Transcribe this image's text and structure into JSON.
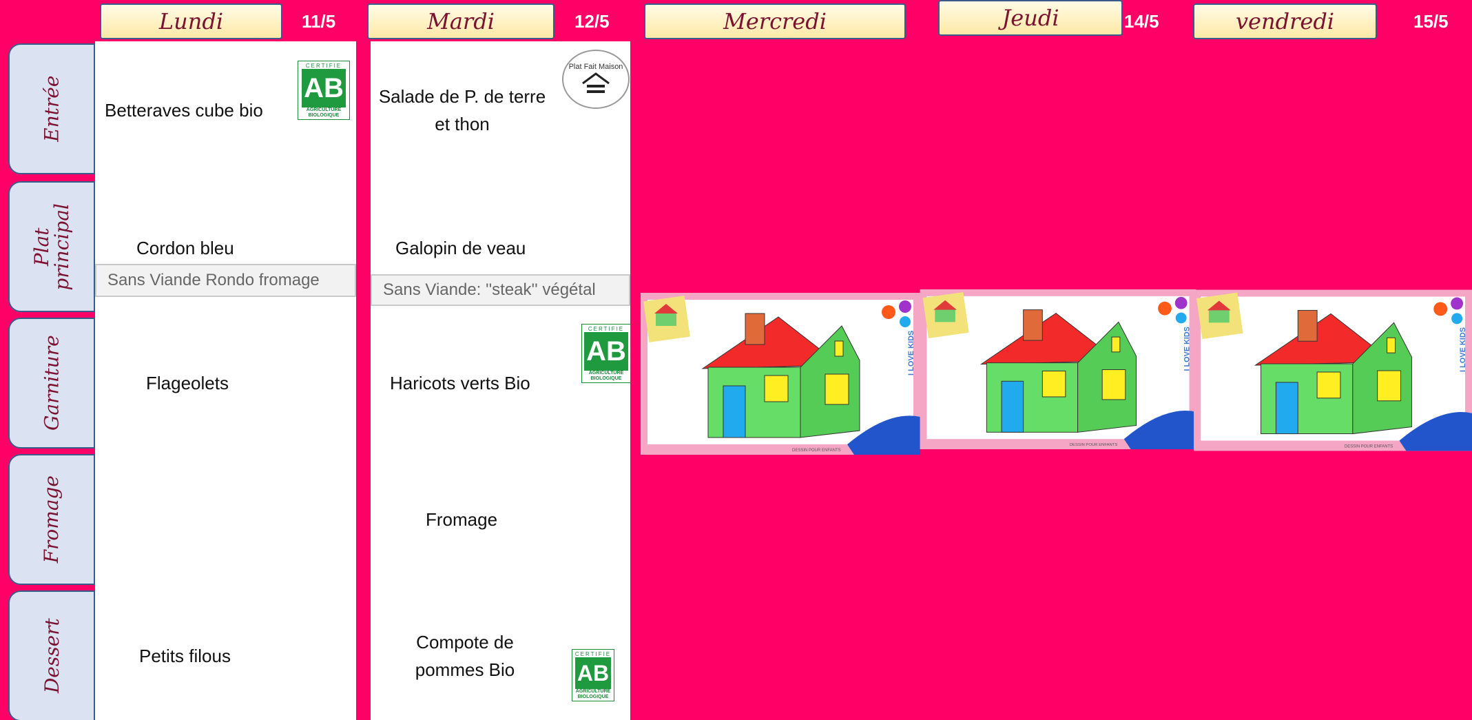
{
  "days": [
    {
      "name": "Lundi",
      "date": "11/5"
    },
    {
      "name": "Mardi",
      "date": "12/5"
    },
    {
      "name": "Mercredi",
      "date": ""
    },
    {
      "name": "Jeudi",
      "date": "14/5"
    },
    {
      "name": "vendredi",
      "date": "15/5"
    }
  ],
  "rows": [
    "Entrée",
    "Plat principal",
    "Garniture",
    "Fromage",
    "Dessert"
  ],
  "monday": {
    "entree": "Betteraves cube bio",
    "plat": "Cordon bleu",
    "sans_viande": "Sans Viande Rondo fromage",
    "garniture": "Flageolets",
    "fromage": "",
    "dessert": "Petits filous"
  },
  "tuesday": {
    "entree": "Salade de P. de terre et thon",
    "plat": "Galopin de veau",
    "sans_viande": "Sans Viande: ''steak''  végétal",
    "garniture": "Haricots verts Bio",
    "fromage": "Fromage",
    "dessert": "Compote de pommes Bio"
  },
  "labels": {
    "ab_certifie": "CERTIFIE",
    "ab_logo": "AB",
    "ab_bottom": "AGRICULTURE BIOLOGIQUE",
    "fait_maison": "Plat Fait Maison",
    "i_love_kids": "I LOVE KIDS",
    "dessin": "DESSIN POUR ENFANTS"
  },
  "colors": {
    "background": "#ff0066",
    "header_text": "#7a1230",
    "bio_green": "#1f9a3f"
  }
}
